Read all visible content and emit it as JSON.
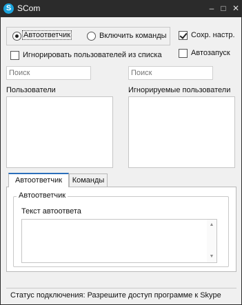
{
  "window": {
    "title": "SCom",
    "app_icon_letter": "S"
  },
  "mode": {
    "options": [
      {
        "label": "Автоответчик",
        "selected": true
      },
      {
        "label": "Включить команды",
        "selected": false
      }
    ]
  },
  "options": {
    "save_settings": {
      "label": "Сохр. настр.",
      "checked": true
    },
    "ignore_users": {
      "label": "Игнорировать пользователей из списка",
      "checked": false
    },
    "autostart": {
      "label": "Автозапуск",
      "checked": false
    }
  },
  "search": {
    "users_placeholder": "Поиск",
    "ignored_placeholder": "Поиск"
  },
  "lists": {
    "users_label": "Пользователи",
    "ignored_label": "Игнорируемые пользователи"
  },
  "tabs": [
    {
      "label": "Автоответчик",
      "active": true
    },
    {
      "label": "Команды",
      "active": false
    }
  ],
  "autoresponder": {
    "group_title": "Автоответчик",
    "text_label": "Текст автоответа",
    "text_value": ""
  },
  "status": {
    "text": "Статус подключения: Разрешите доступ программе к Skype"
  },
  "colors": {
    "titlebar": "#2b2b2b",
    "app_icon": "#1ba3dc",
    "tab_accent": "#2a6ebb"
  }
}
